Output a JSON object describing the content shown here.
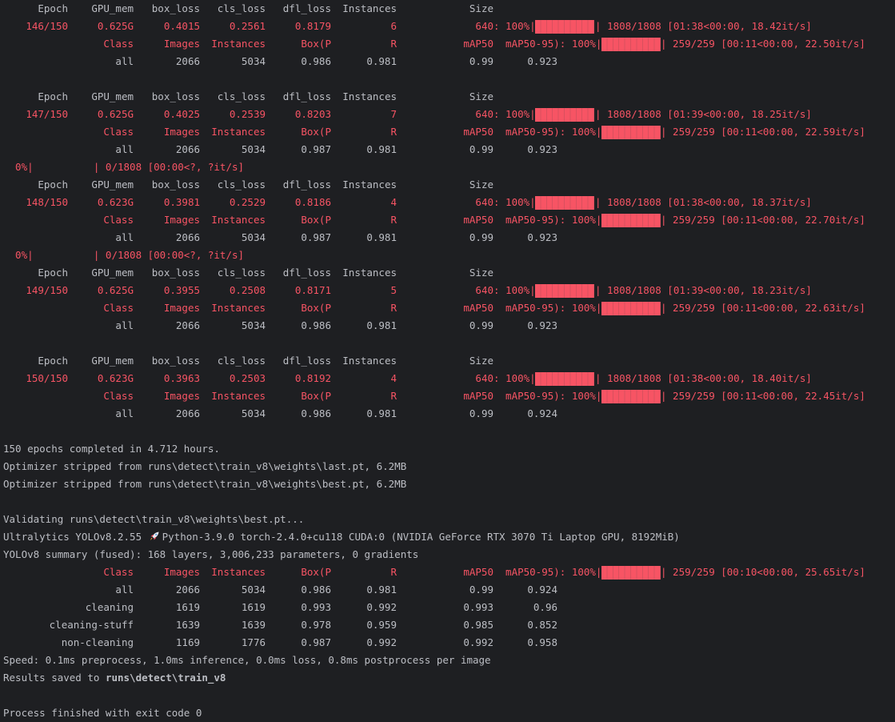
{
  "colors": {
    "background": "#1e1f22",
    "text": "#bcbec4",
    "accent_red": "#f75464"
  },
  "train_header": [
    "Epoch",
    "GPU_mem",
    "box_loss",
    "cls_loss",
    "dfl_loss",
    "Instances",
    "Size"
  ],
  "val_header": [
    "Class",
    "Images",
    "Instances",
    "Box(P",
    "R",
    "mAP50"
  ],
  "epochs": [
    {
      "values": [
        "146/150",
        "0.625G",
        "0.4015",
        "0.2561",
        "0.8179",
        "6",
        "640"
      ],
      "train_progress": {
        "label": ": 100%|",
        "fill": 1.0,
        "tail": "| 1808/1808 [01:38<00:00, 18.42it/s]"
      },
      "val_progress": {
        "label": "  mAP50-95): 100%|",
        "fill": 1.0,
        "tail": "| 259/259 [00:11<00:00, 22.50it/s]"
      },
      "all": [
        "all",
        "2066",
        "5034",
        "0.986",
        "0.981",
        "0.99",
        "0.923"
      ],
      "after": ""
    },
    {
      "values": [
        "147/150",
        "0.625G",
        "0.4025",
        "0.2539",
        "0.8203",
        "7",
        "640"
      ],
      "train_progress": {
        "label": ": 100%|",
        "fill": 1.0,
        "tail": "| 1808/1808 [01:39<00:00, 18.25it/s]"
      },
      "val_progress": {
        "label": "  mAP50-95): 100%|",
        "fill": 1.0,
        "tail": "| 259/259 [00:11<00:00, 22.59it/s]"
      },
      "all": [
        "all",
        "2066",
        "5034",
        "0.987",
        "0.981",
        "0.99",
        "0.923"
      ],
      "after": "  0%|          | 0/1808 [00:00<?, ?it/s]"
    },
    {
      "values": [
        "148/150",
        "0.623G",
        "0.3981",
        "0.2529",
        "0.8186",
        "4",
        "640"
      ],
      "train_progress": {
        "label": ": 100%|",
        "fill": 1.0,
        "tail": "| 1808/1808 [01:38<00:00, 18.37it/s]"
      },
      "val_progress": {
        "label": "  mAP50-95): 100%|",
        "fill": 1.0,
        "tail": "| 259/259 [00:11<00:00, 22.70it/s]"
      },
      "all": [
        "all",
        "2066",
        "5034",
        "0.987",
        "0.981",
        "0.99",
        "0.923"
      ],
      "after": "  0%|          | 0/1808 [00:00<?, ?it/s]"
    },
    {
      "values": [
        "149/150",
        "0.625G",
        "0.3955",
        "0.2508",
        "0.8171",
        "5",
        "640"
      ],
      "train_progress": {
        "label": ": 100%|",
        "fill": 1.0,
        "tail": "| 1808/1808 [01:39<00:00, 18.23it/s]"
      },
      "val_progress": {
        "label": "  mAP50-95): 100%|",
        "fill": 1.0,
        "tail": "| 259/259 [00:11<00:00, 22.63it/s]"
      },
      "all": [
        "all",
        "2066",
        "5034",
        "0.986",
        "0.981",
        "0.99",
        "0.923"
      ],
      "after": ""
    },
    {
      "values": [
        "150/150",
        "0.623G",
        "0.3963",
        "0.2503",
        "0.8192",
        "4",
        "640"
      ],
      "train_progress": {
        "label": ": 100%|",
        "fill": 1.0,
        "tail": "| 1808/1808 [01:38<00:00, 18.40it/s]"
      },
      "val_progress": {
        "label": "  mAP50-95): 100%|",
        "fill": 1.0,
        "tail": "| 259/259 [00:11<00:00, 22.45it/s]"
      },
      "all": [
        "all",
        "2066",
        "5034",
        "0.986",
        "0.981",
        "0.99",
        "0.924"
      ],
      "after": ""
    }
  ],
  "summary": {
    "completed": "150 epochs completed in 4.712 hours.",
    "strip_last": "Optimizer stripped from runs\\detect\\train_v8\\weights\\last.pt, 6.2MB",
    "strip_best": "Optimizer stripped from runs\\detect\\train_v8\\weights\\best.pt, 6.2MB",
    "validating": "Validating runs\\detect\\train_v8\\weights\\best.pt...",
    "env_prefix": "Ultralytics YOLOv8.2.55",
    "env_icon": "rocket-icon",
    "env_suffix": "Python-3.9.0 torch-2.4.0+cu118 CUDA:0 (NVIDIA GeForce RTX 3070 Ti Laptop GPU, 8192MiB)",
    "model_summary": "YOLOv8 summary (fused): 168 layers, 3,006,233 parameters, 0 gradients"
  },
  "final_val": {
    "progress": {
      "label": "  mAP50-95): 100%|",
      "fill": 1.0,
      "tail": "| 259/259 [00:10<00:00, 25.65it/s]"
    },
    "rows": [
      [
        "all",
        "2066",
        "5034",
        "0.986",
        "0.981",
        "0.99",
        "0.924"
      ],
      [
        "cleaning",
        "1619",
        "1619",
        "0.993",
        "0.992",
        "0.993",
        "0.96"
      ],
      [
        "cleaning-stuff",
        "1639",
        "1639",
        "0.978",
        "0.959",
        "0.985",
        "0.852"
      ],
      [
        "non-cleaning",
        "1169",
        "1776",
        "0.987",
        "0.992",
        "0.992",
        "0.958"
      ]
    ]
  },
  "footer": {
    "speed": "Speed: 0.1ms preprocess, 1.0ms inference, 0.0ms loss, 0.8ms postprocess per image",
    "results_prefix": "Results saved to ",
    "results_path": "runs\\detect\\train_v8",
    "exit": "Process finished with exit code 0"
  }
}
